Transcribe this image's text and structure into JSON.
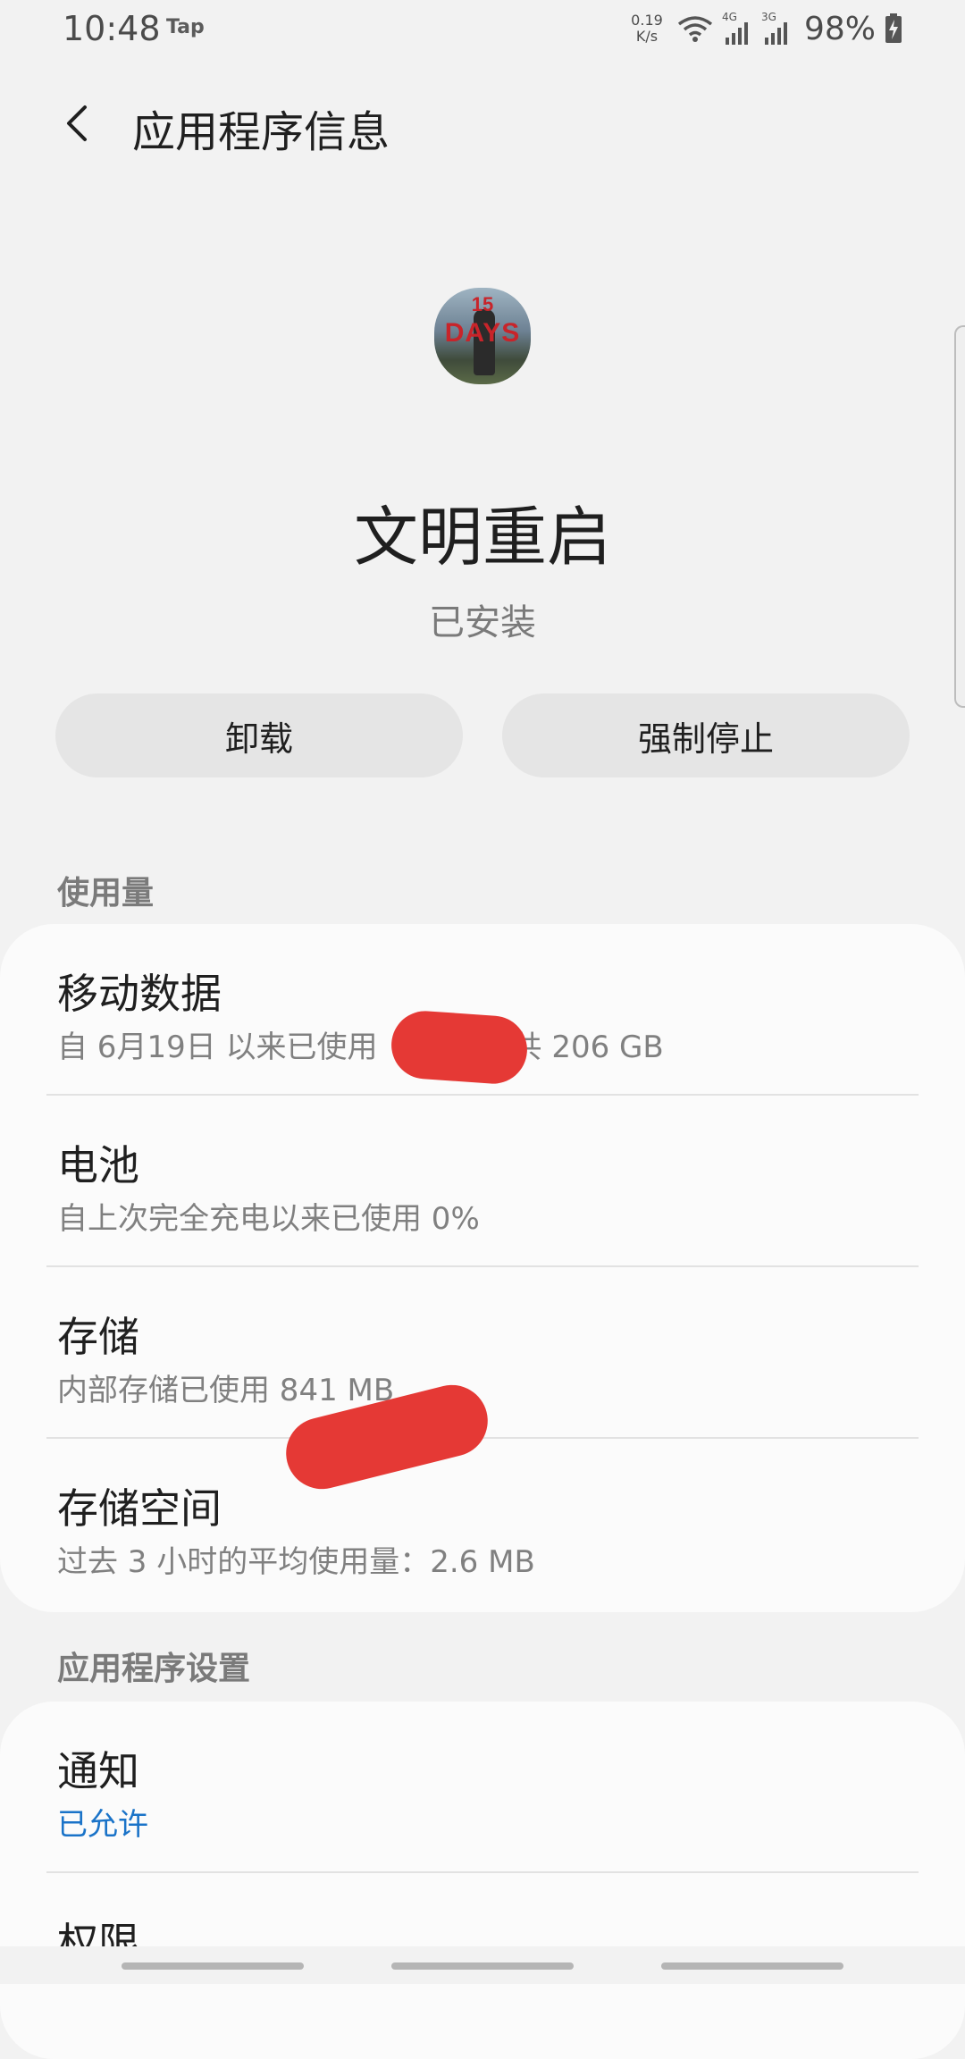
{
  "status_bar": {
    "time": "10:48",
    "notification": "Tap",
    "net_speed_value": "0.19",
    "net_speed_unit": "K/s",
    "signal_4g": "4G",
    "signal_3g": "3G",
    "battery": "98%"
  },
  "header": {
    "title": "应用程序信息"
  },
  "app": {
    "icon_text": "DAYS",
    "icon_number": "15",
    "name": "文明重启",
    "status": "已安装"
  },
  "actions": {
    "uninstall_label": "卸载",
    "force_stop_label": "强制停止"
  },
  "usage_section": {
    "header": "使用量",
    "items": [
      {
        "title": "移动数据",
        "subtitle": "自 6月19日 以来已使用",
        "subtitle_tail": "共 206 GB"
      },
      {
        "title": "电池",
        "subtitle": "自上次完全充电以来已使用 0%"
      },
      {
        "title": "存储",
        "subtitle": "内部存储已使用 841 MB"
      },
      {
        "title": "存储空间",
        "subtitle": "过去 3 小时的平均使用量：2.6 MB"
      }
    ]
  },
  "settings_section": {
    "header": "应用程序设置",
    "items": [
      {
        "title": "通知",
        "subtitle": "已允许"
      },
      {
        "title": "权限"
      }
    ]
  },
  "colors": {
    "background": "#f2f2f2",
    "card": "#fbfbfb",
    "accent": "#1a73c8",
    "redaction": "#e53935"
  }
}
